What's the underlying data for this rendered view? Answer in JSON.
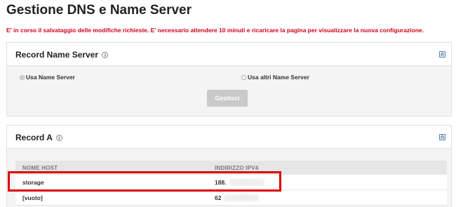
{
  "page": {
    "title": "Gestione DNS e Name Server",
    "warning": "E' in corso il salvataggio delle modifiche richieste. E' necessario attendere 10 minuti e ricaricare la pagina per visualizzare la nuova configurazione."
  },
  "nameserver_panel": {
    "title": "Record Name Server",
    "info_icon": "info-icon",
    "collapse_icon": "collapse-icon",
    "radio_default": "Usa Name Server",
    "radio_other": "Usa altri Name Server",
    "button": "Gestisci"
  },
  "a_panel": {
    "title": "Record A",
    "info_icon": "info-icon",
    "collapse_icon": "collapse-icon",
    "columns": [
      "NOME HOST",
      "INDIRIZZO IPV4"
    ],
    "rows": [
      {
        "host": "storage",
        "ip": "188."
      },
      {
        "host": "[vuoto]",
        "ip": "62"
      }
    ]
  },
  "colors": {
    "warning": "#d0021b",
    "highlight": "#e00000",
    "button_disabled": "#c9c9c9"
  }
}
